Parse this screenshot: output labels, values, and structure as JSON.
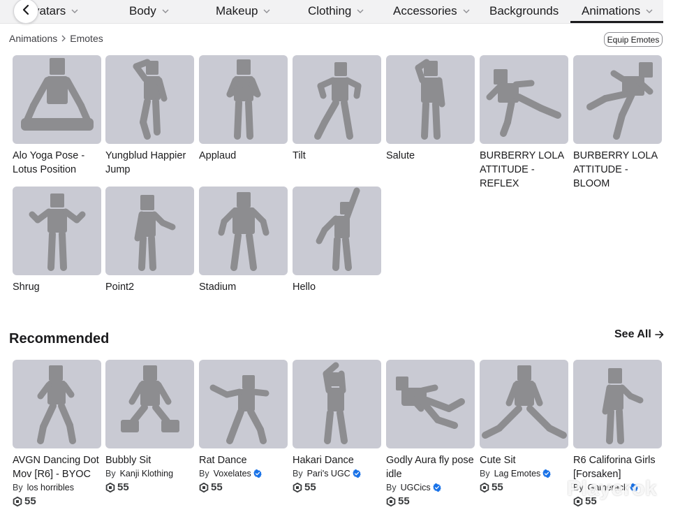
{
  "nav": {
    "tabs": [
      {
        "label": "vatars",
        "chevron": true
      },
      {
        "label": "Body",
        "chevron": true
      },
      {
        "label": "Makeup",
        "chevron": true
      },
      {
        "label": "Clothing",
        "chevron": true
      },
      {
        "label": "Accessories",
        "chevron": true
      },
      {
        "label": "Backgrounds",
        "chevron": false
      },
      {
        "label": "Animations",
        "chevron": true,
        "active": true
      }
    ]
  },
  "breadcrumb": {
    "parent": "Animations",
    "current": "Emotes"
  },
  "equip_button": "Equip Emotes",
  "emotes": [
    {
      "title": "Alo Yoga Pose - Lotus Position",
      "pose": "lotus"
    },
    {
      "title": "Yungblud Happier Jump",
      "pose": "happier"
    },
    {
      "title": "Applaud",
      "pose": "applaud"
    },
    {
      "title": "Tilt",
      "pose": "tilt"
    },
    {
      "title": "Salute",
      "pose": "salute"
    },
    {
      "title": "BURBERRY LOLA ATTITUDE - REFLEX",
      "pose": "reflex"
    },
    {
      "title": "BURBERRY LOLA ATTITUDE - BLOOM",
      "pose": "bloom"
    },
    {
      "title": "Shrug",
      "pose": "shrug"
    },
    {
      "title": "Point2",
      "pose": "point"
    },
    {
      "title": "Stadium",
      "pose": "stadium"
    },
    {
      "title": "Hello",
      "pose": "hello"
    }
  ],
  "recommended": {
    "title": "Recommended",
    "see_all": "See All",
    "by_label": "By",
    "items": [
      {
        "title": "AVGN Dancing Dot Mov [R6] - BYOC",
        "creator": "los horribles",
        "verified": false,
        "price": "55",
        "pose": "walk"
      },
      {
        "title": "Bubbly Sit",
        "creator": "Kanji Klothing",
        "verified": false,
        "price": "55",
        "pose": "sit"
      },
      {
        "title": "Rat Dance",
        "creator": "Voxelates",
        "verified": true,
        "price": "55",
        "pose": "rat"
      },
      {
        "title": "Hakari Dance",
        "creator": "Pari's UGC",
        "verified": true,
        "price": "55",
        "pose": "hakari"
      },
      {
        "title": "Godly Aura fly pose idle",
        "creator": "UGCics",
        "verified": true,
        "price": "55",
        "pose": "fly"
      },
      {
        "title": "Cute Sit",
        "creator": "Lag Emotes",
        "verified": true,
        "price": "55",
        "pose": "split"
      },
      {
        "title": "R6 Califorina Girls [Forsaken]",
        "creator": "Gamerack",
        "verified": true,
        "price": "55",
        "pose": "point"
      }
    ]
  },
  "watermark": "Playerok",
  "colors": {
    "thumb_bg": "#c9cad3",
    "figure": "#8d8d90",
    "verified": "#1a73e8",
    "text": "#1b1b1d"
  }
}
